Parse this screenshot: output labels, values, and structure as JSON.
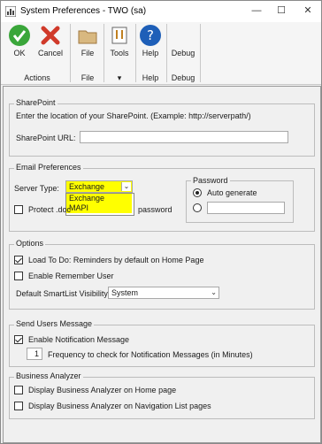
{
  "window": {
    "title": "System Preferences  -  TWO (sa)",
    "minimize": "—",
    "maximize": "☐",
    "close": "✕"
  },
  "ribbon": {
    "ok_label": "OK",
    "cancel_label": "Cancel",
    "file_label": "File",
    "tools_label": "Tools",
    "help_label": "Help",
    "debug_label": "Debug",
    "groups": {
      "actions": "Actions",
      "file": "File",
      "tools": "▾",
      "help": "Help",
      "debug": "Debug"
    }
  },
  "sharepoint": {
    "legend": "SharePoint",
    "instruction": "Enter the location of your SharePoint. (Example: http://serverpath/)",
    "url_label": "SharePoint URL:",
    "url_value": ""
  },
  "email": {
    "legend": "Email Preferences",
    "server_type_label": "Server Type:",
    "server_type_value": "Exchange",
    "options": [
      "Exchange",
      "MAPI"
    ],
    "protect_label_start": "Protect .doc",
    "protect_label_end": "password",
    "password_legend": "Password",
    "auto_generate_label": "Auto generate",
    "password_value": ""
  },
  "options": {
    "legend": "Options",
    "load_todo_label": "Load To Do: Reminders by default on Home Page",
    "remember_user_label": "Enable Remember User",
    "smartlist_label": "Default SmartList Visibility:",
    "smartlist_value": "System"
  },
  "send_users": {
    "legend": "Send Users Message",
    "enable_notification_label": "Enable Notification Message",
    "frequency_value": "1",
    "frequency_label": "Frequency to check for Notification Messages (in Minutes)"
  },
  "business_analyzer": {
    "legend": "Business Analyzer",
    "home_page_label": "Display Business Analyzer on Home page",
    "nav_list_label": "Display Business Analyzer on Navigation List pages"
  },
  "colors": {
    "accent": "#1e6fd0",
    "highlight_yellow": "#ffff00",
    "ok_green": "#3aa63a",
    "cancel_red": "#d03a2a"
  }
}
